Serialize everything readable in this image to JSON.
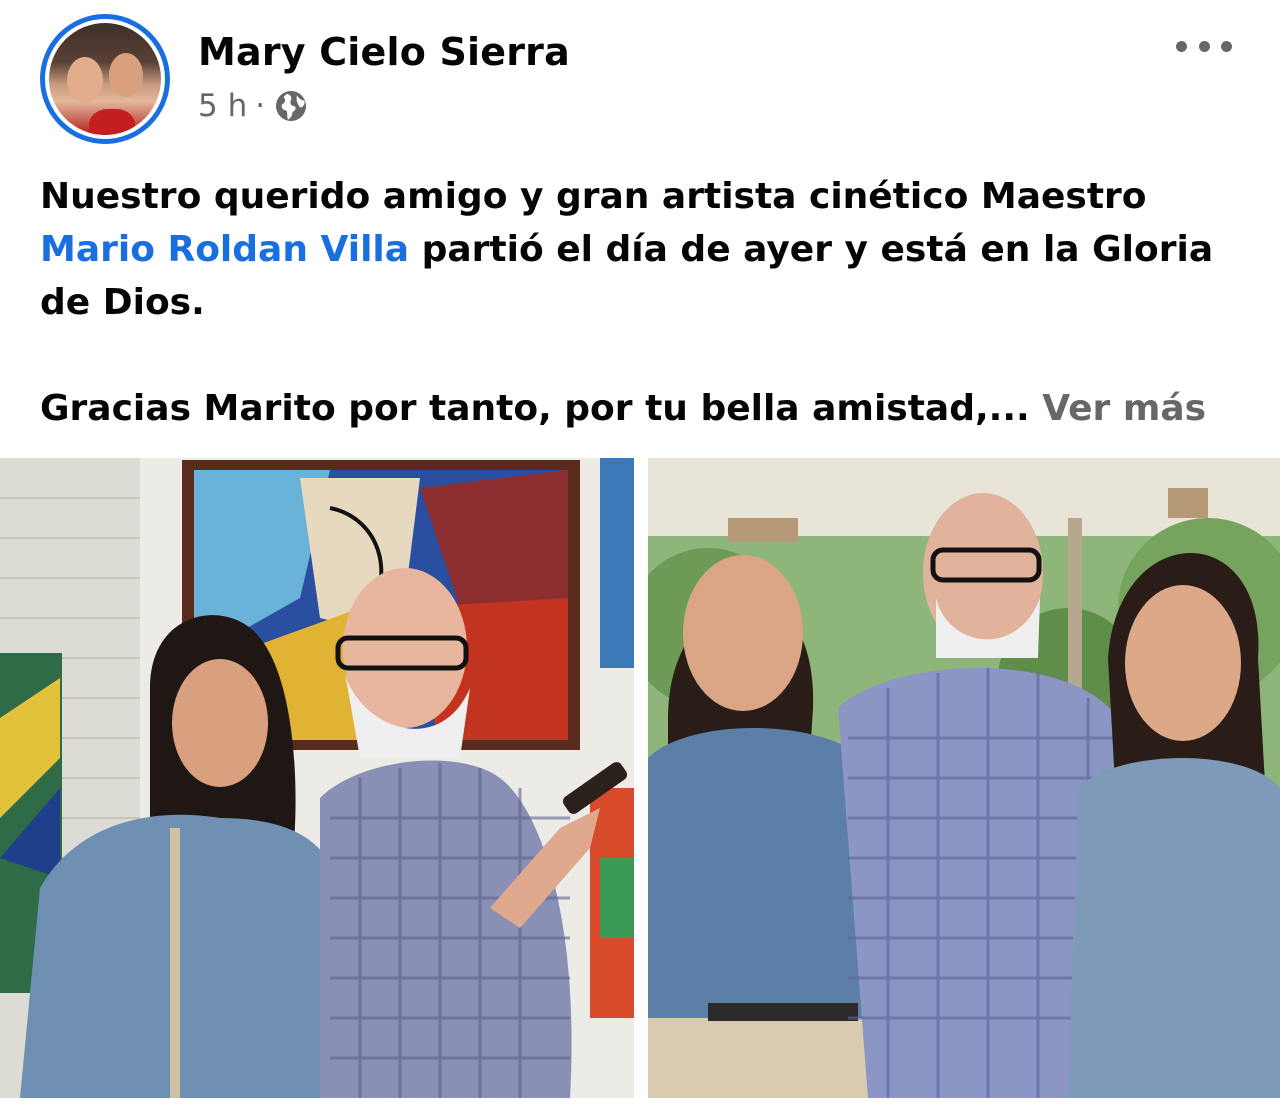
{
  "author": {
    "name": "Mary Cielo Sierra",
    "time": "5 h",
    "separator": "·",
    "audience_icon": "globe-icon"
  },
  "menu_icon": "more-horizontal-icon",
  "post": {
    "line1": "Nuestro querido amigo y gran artista cinético Maestro",
    "mention": "Mario Roldan Villa",
    "line2_rest": " partió el día de ayer y está en la Gloria de Dios.",
    "line3": "Gracias Marito por tanto, por tu bella amistad,...",
    "see_more": "Ver más"
  },
  "photos": [
    "photo-studio-portrait",
    "photo-outdoor-group"
  ],
  "colors": {
    "link": "#1a6fe0",
    "secondary_text": "#65676b",
    "avatar_ring": "#1a6fe0"
  }
}
